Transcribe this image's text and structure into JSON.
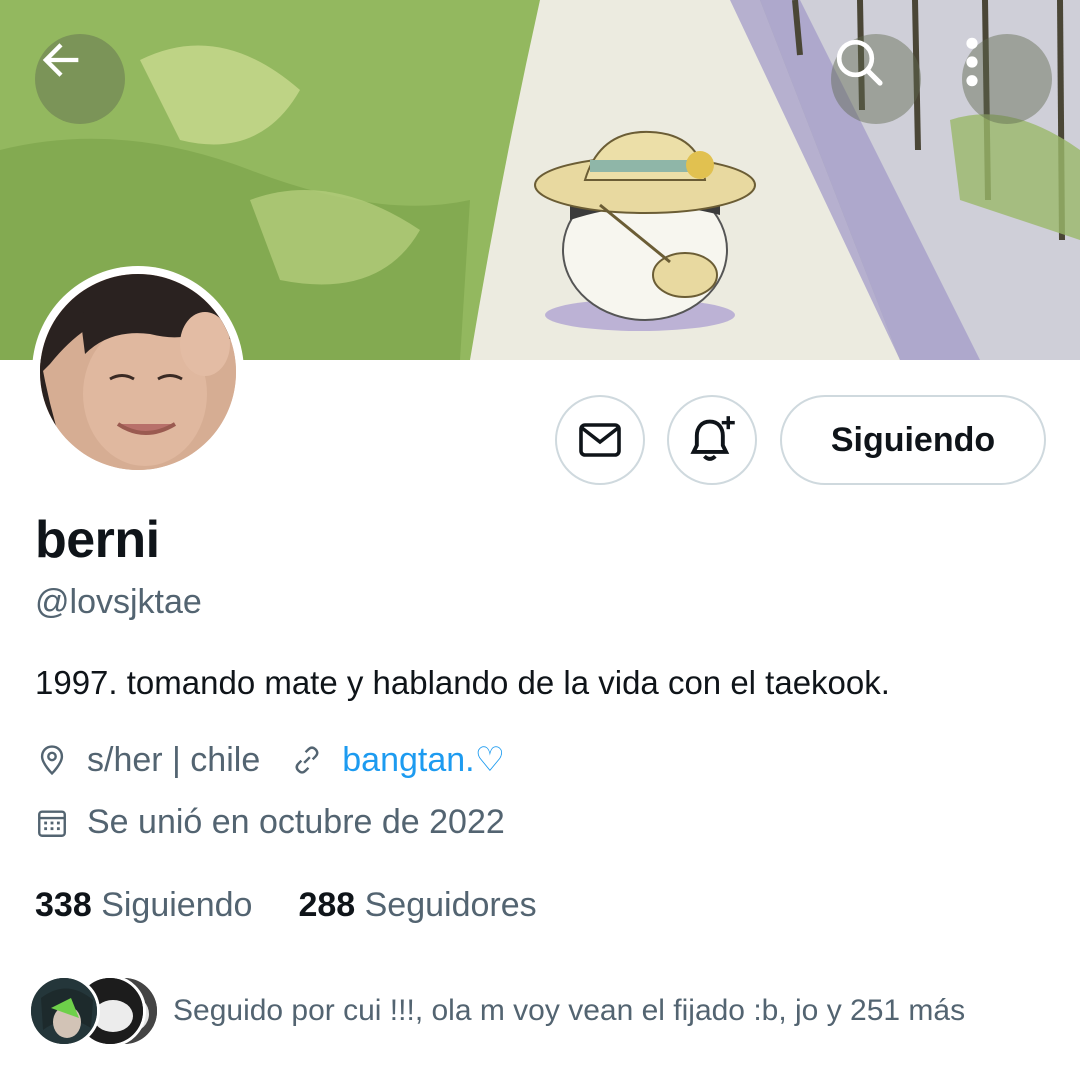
{
  "header": {
    "back_icon": "arrow-left-icon",
    "search_icon": "search-icon",
    "more_icon": "more-vertical-icon"
  },
  "profile": {
    "name": "berni",
    "handle": "@lovsjktae",
    "bio": "1997. tomando mate y hablando de la vida con el taekook.",
    "location": "s/her | chile",
    "website": "bangtan.♡",
    "joined": "Se unió en octubre de 2022"
  },
  "actions": {
    "message_icon": "mail-icon",
    "notify_icon": "bell-plus-icon",
    "follow_label": "Siguiendo"
  },
  "stats": {
    "following_count": "338",
    "following_label": "Siguiendo",
    "followers_count": "288",
    "followers_label": "Seguidores"
  },
  "followed_by": {
    "text": "Seguido por cui !!!, ola m voy vean el fijado :b, jo y 251 más"
  },
  "colors": {
    "accent": "#1d9bf0",
    "secondary_text": "#536471",
    "border": "#cfd9de"
  }
}
